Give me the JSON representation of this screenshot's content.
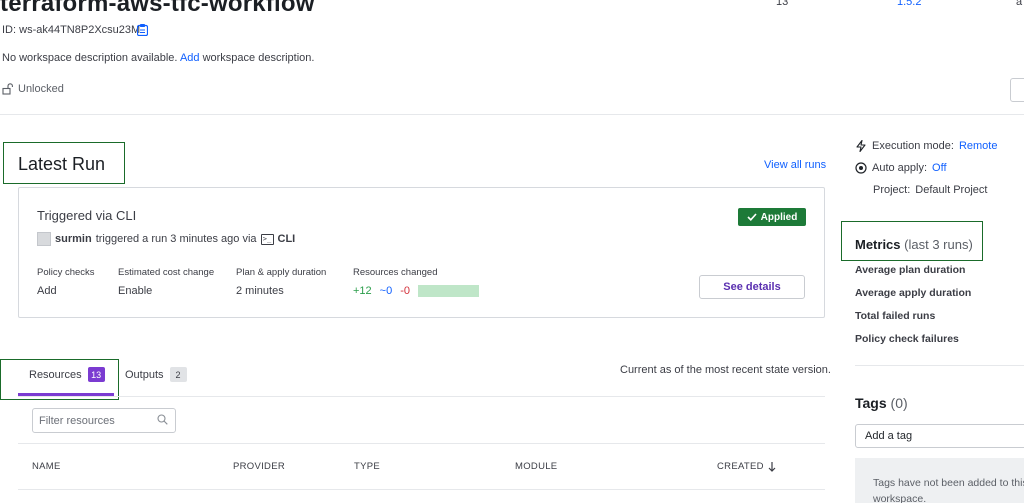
{
  "header": {
    "title": "terraform-aws-tfc-workflow",
    "id_label": "ID:",
    "id_value": "ws-ak44TN8P2Xcsu23M",
    "description_prefix": "No workspace description available.",
    "description_link": "Add",
    "description_suffix": "workspace description.",
    "lock_status": "Unlocked",
    "stats": {
      "resources_value": "13",
      "terraform_version_value": "1.5.2",
      "third_value": "a"
    }
  },
  "latest_run": {
    "title": "Latest Run",
    "view_all": "View all runs",
    "run_title": "Triggered via CLI",
    "status_badge": "Applied",
    "user": "surmin",
    "meta_text": "triggered a run 3 minutes ago via",
    "meta_source": "CLI",
    "columns": [
      {
        "label": "Policy checks",
        "value": "Add"
      },
      {
        "label": "Estimated cost change",
        "value": "Enable"
      },
      {
        "label": "Plan & apply duration",
        "value": "2 minutes"
      },
      {
        "label": "Resources changed",
        "value": ""
      }
    ],
    "changes": {
      "added": "+12",
      "changed": "~0",
      "destroyed": "-0"
    },
    "see_details": "See details"
  },
  "tabs": [
    {
      "label": "Resources",
      "count": "13",
      "active": true
    },
    {
      "label": "Outputs",
      "count": "2",
      "active": false
    }
  ],
  "resources": {
    "current_as_of": "Current as of the most recent state version.",
    "filter_placeholder": "Filter resources",
    "columns": [
      "NAME",
      "PROVIDER",
      "TYPE",
      "MODULE",
      "CREATED"
    ]
  },
  "sidebar": {
    "execution_mode_label": "Execution mode:",
    "execution_mode_value": "Remote",
    "auto_apply_label": "Auto apply:",
    "auto_apply_value": "Off",
    "project_label": "Project:",
    "project_value": "Default Project",
    "metrics_title": "Metrics",
    "metrics_subtitle": "(last 3 runs)",
    "metrics": [
      "Average plan duration",
      "Average apply duration",
      "Total failed runs",
      "Policy check failures"
    ],
    "tags_title": "Tags",
    "tags_count": "(0)",
    "add_tag": "Add a tag",
    "tags_empty": "Tags have not been added to this workspace."
  },
  "colors": {
    "accent_purple": "#7b3bd1",
    "link_blue": "#1060ff",
    "success_green": "#1d7a38",
    "highlight_green": "#1a6b2a"
  },
  "icons": [
    "copy-icon",
    "lock-open-icon",
    "check-icon",
    "user-avatar-icon",
    "terminal-icon",
    "search-icon",
    "lightning-icon",
    "auto-apply-icon",
    "arrow-down-icon"
  ]
}
